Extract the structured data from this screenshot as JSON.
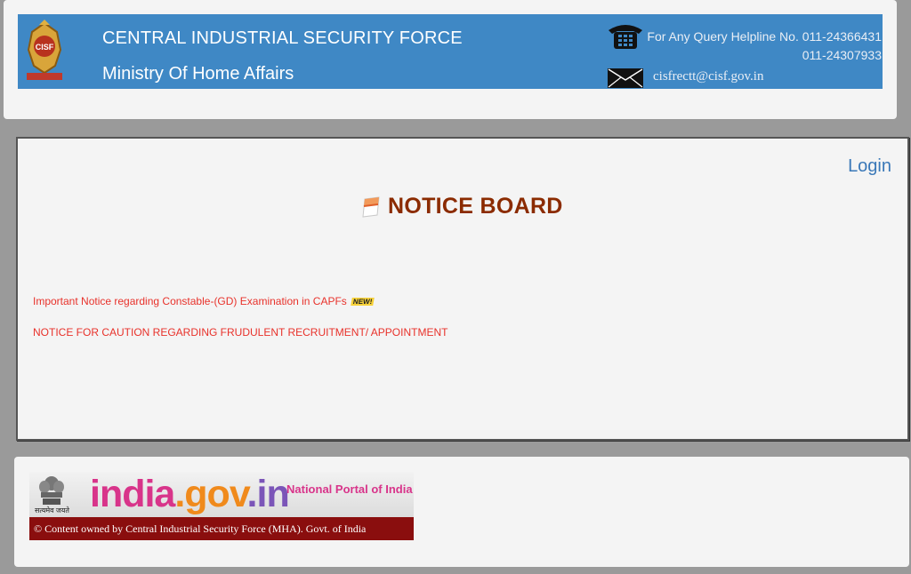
{
  "header": {
    "org_name": "CENTRAL INDUSTRIAL SECURITY FORCE",
    "ministry": "Ministry Of Home Affairs",
    "emblem_text": "CISF",
    "helpline_line1": "For Any Query Helpline No. 011-24366431",
    "helpline_line2": "011-24307933",
    "email": "cisfrectt@cisf.gov.in",
    "icons": [
      "cisf-emblem-icon",
      "phone-icon",
      "mail-icon"
    ],
    "banner_color": "#3f88c5"
  },
  "notice_board": {
    "login_label": "Login",
    "title": "NOTICE BOARD",
    "notices": [
      {
        "text": "Important Notice regarding Constable-(GD) Examination in CAPFs",
        "badge": "NEW!"
      },
      {
        "text": "NOTICE FOR CAUTION REGARDING FRUDULENT RECRUITMENT/ APPOINTMENT"
      }
    ],
    "title_color": "#8b2b00",
    "link_color": "#e8322b"
  },
  "footer": {
    "satyamev": "सत्यमेव जयते",
    "portal_part1": "india",
    "portal_part2": ".gov",
    "portal_part3": ".in",
    "portal_tagline": "National Portal of India",
    "copyright": "© Content owned by Central Industrial Security Force (MHA). Govt. of India"
  }
}
